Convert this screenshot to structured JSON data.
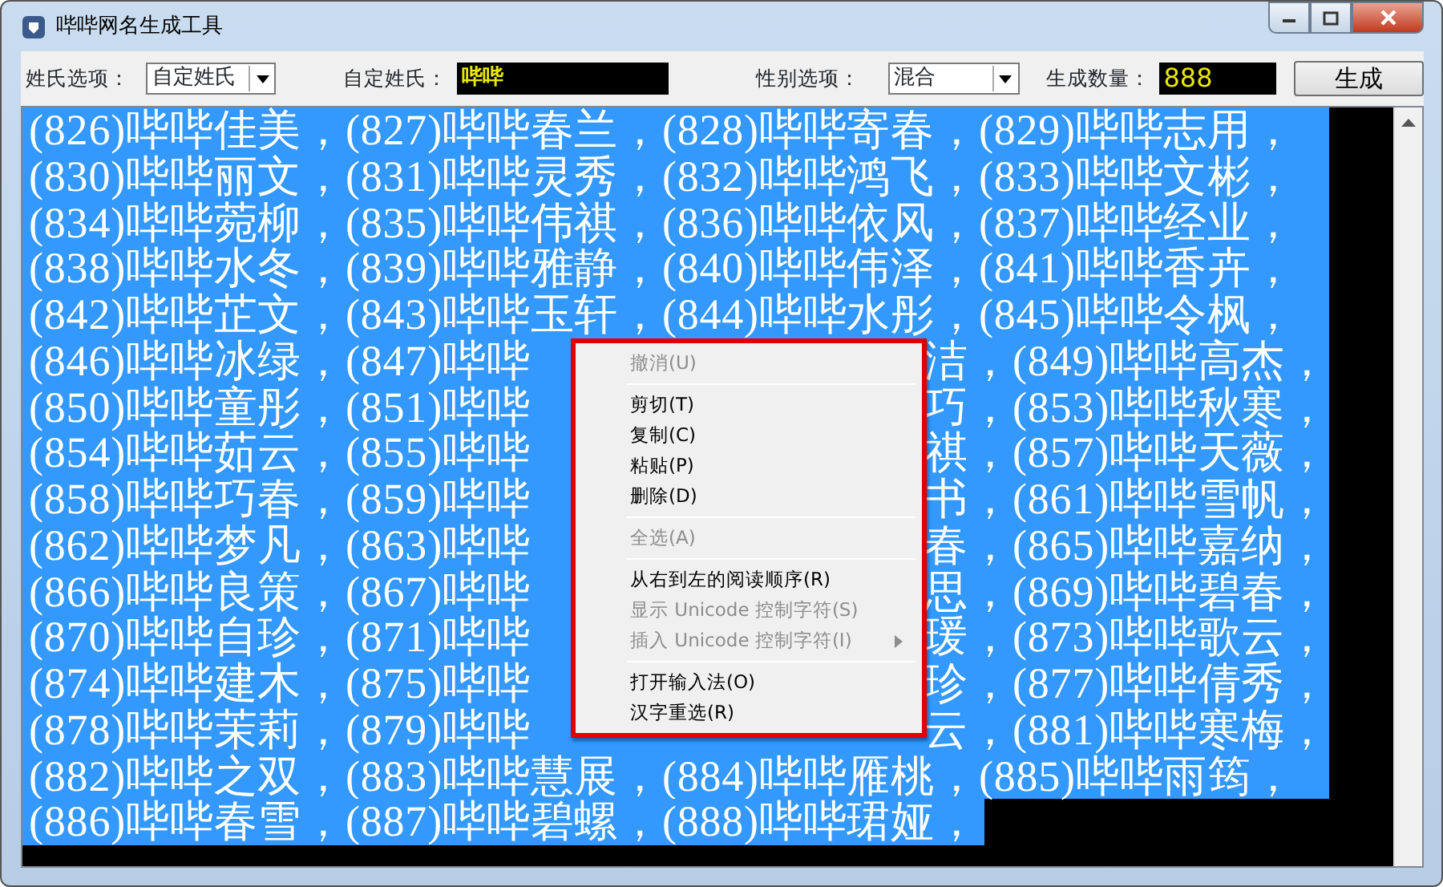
{
  "window": {
    "title": "哔哔网名生成工具"
  },
  "toolbar": {
    "surname_option": {
      "label": "姓氏选项：",
      "value": "自定姓氏"
    },
    "custom_surname": {
      "label": "自定姓氏：",
      "value": "哔哔"
    },
    "gender_option": {
      "label": "性别选项：",
      "value": "混合"
    },
    "count": {
      "label": "生成数量：",
      "value": "888"
    },
    "generate_button": "生成"
  },
  "output": {
    "lines": [
      {
        "segments": [
          "(826)哔哔佳美，(827)哔哔春兰，(828)哔哔寄春，(829)哔哔志用，"
        ]
      },
      {
        "segments": [
          "(830)哔哔丽文，(831)哔哔灵秀，(832)哔哔鸿飞，(833)哔哔文彬，"
        ]
      },
      {
        "segments": [
          "(834)哔哔菀柳，(835)哔哔伟祺，(836)哔哔依风，(837)哔哔经业，"
        ]
      },
      {
        "segments": [
          "(838)哔哔水冬，(839)哔哔雅静，(840)哔哔伟泽，(841)哔哔香卉，"
        ]
      },
      {
        "segments": [
          "(842)哔哔芷文，(843)哔哔玉轩，(844)哔哔水彤，(845)哔哔令枫，"
        ]
      },
      {
        "segments": [
          "(846)哔哔冰绿，(847)哔哔",
          "洁，(849)哔哔高杰，"
        ]
      },
      {
        "segments": [
          "(850)哔哔童彤，(851)哔哔",
          "巧，(853)哔哔秋寒，"
        ]
      },
      {
        "segments": [
          "(854)哔哔茹云，(855)哔哔",
          "祺，(857)哔哔天薇，"
        ]
      },
      {
        "segments": [
          "(858)哔哔巧春，(859)哔哔",
          "书，(861)哔哔雪帆，"
        ]
      },
      {
        "segments": [
          "(862)哔哔梦凡，(863)哔哔",
          "春，(865)哔哔嘉纳，"
        ]
      },
      {
        "segments": [
          "(866)哔哔良策，(867)哔哔",
          "思，(869)哔哔碧春，"
        ]
      },
      {
        "segments": [
          "(870)哔哔自珍，(871)哔哔",
          "瑗，(873)哔哔歌云，"
        ]
      },
      {
        "segments": [
          "(874)哔哔建木，(875)哔哔",
          "珍，(877)哔哔倩秀，"
        ]
      },
      {
        "segments": [
          "(878)哔哔茉莉，(879)哔哔",
          "云，(881)哔哔寒梅，"
        ]
      },
      {
        "segments": [
          "(882)哔哔之双，(883)哔哔慧展，(884)哔哔雁桃，(885)哔哔雨筠，"
        ]
      },
      {
        "segments": [
          "(886)哔哔春雪，(887)哔哔碧螺，(888)哔哔珺娅，"
        ]
      }
    ]
  },
  "context_menu": {
    "items": [
      {
        "kind": "item",
        "label": "撤消(U)",
        "disabled": true,
        "submenu": false
      },
      {
        "kind": "separator"
      },
      {
        "kind": "item",
        "label": "剪切(T)",
        "disabled": false,
        "submenu": false
      },
      {
        "kind": "item",
        "label": "复制(C)",
        "disabled": false,
        "submenu": false
      },
      {
        "kind": "item",
        "label": "粘贴(P)",
        "disabled": false,
        "submenu": false
      },
      {
        "kind": "item",
        "label": "删除(D)",
        "disabled": false,
        "submenu": false
      },
      {
        "kind": "separator"
      },
      {
        "kind": "item",
        "label": "全选(A)",
        "disabled": true,
        "submenu": false
      },
      {
        "kind": "separator"
      },
      {
        "kind": "item",
        "label": "从右到左的阅读顺序(R)",
        "disabled": false,
        "submenu": false
      },
      {
        "kind": "item",
        "label": "显示 Unicode 控制字符(S)",
        "disabled": true,
        "submenu": false
      },
      {
        "kind": "item",
        "label": "插入 Unicode 控制字符(I)",
        "disabled": true,
        "submenu": true
      },
      {
        "kind": "separator"
      },
      {
        "kind": "item",
        "label": "打开输入法(O)",
        "disabled": false,
        "submenu": false
      },
      {
        "kind": "item",
        "label": "汉字重选(R)",
        "disabled": false,
        "submenu": false
      }
    ]
  }
}
